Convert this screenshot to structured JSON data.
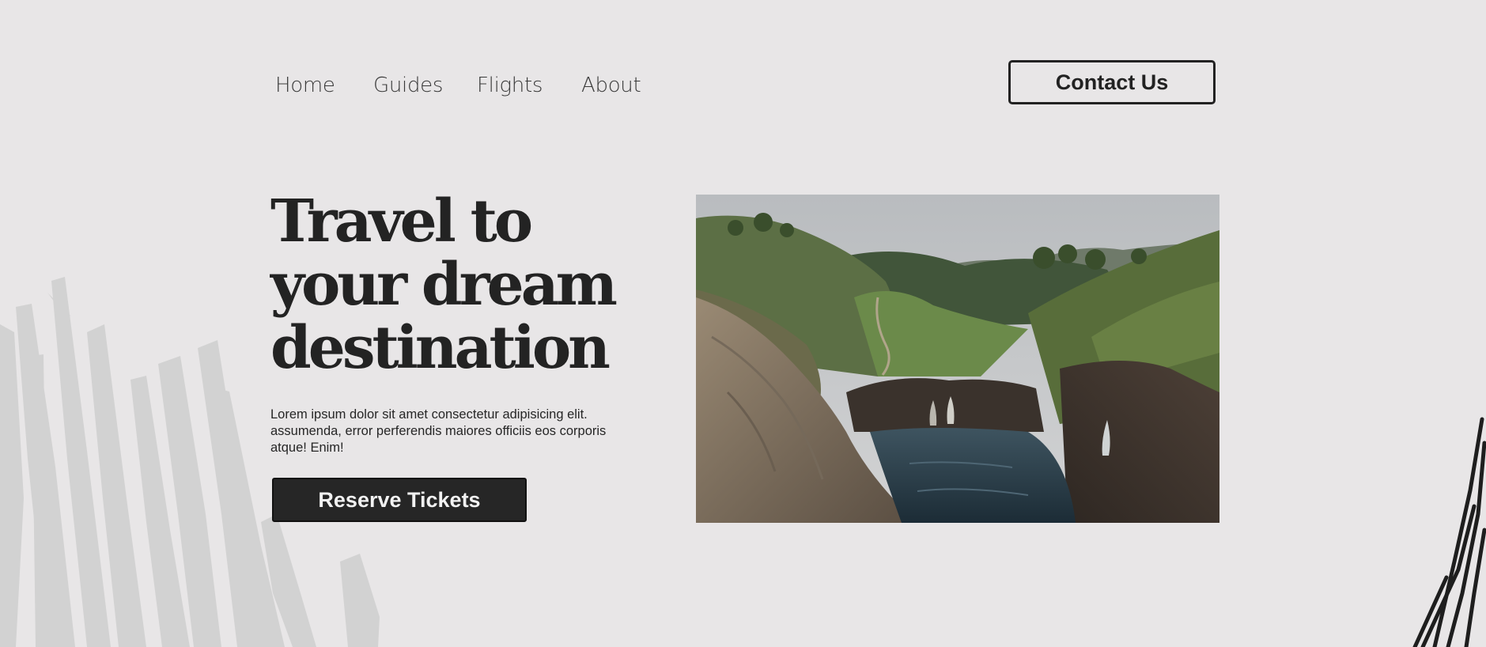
{
  "nav": {
    "items": [
      {
        "label": "Home"
      },
      {
        "label": "Guides"
      },
      {
        "label": "Flights"
      },
      {
        "label": "About"
      }
    ],
    "contact_label": "Contact Us"
  },
  "hero": {
    "headline_lines": [
      "Travel to",
      "your dream",
      "destination"
    ],
    "lead": "Lorem ipsum dolor sit amet consectetur adipisicing elit. assumenda, error perferendis maiores officiis eos corporis atque! Enim!",
    "cta_label": "Reserve Tickets"
  },
  "colors": {
    "background": "#e8e6e7",
    "text": "#222222",
    "button_dark": "#262626",
    "decor_light": "#d0d0d0",
    "decor_dark": "#1e1e1e"
  }
}
